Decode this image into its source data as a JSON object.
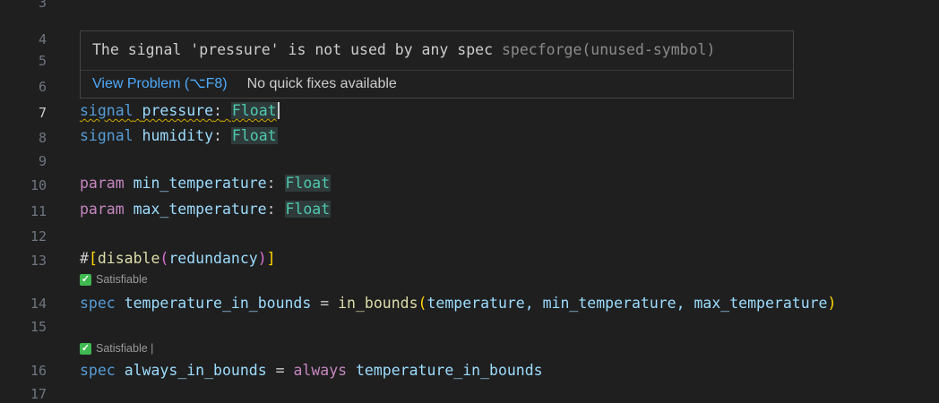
{
  "line_numbers": [
    "3",
    "4",
    "5",
    "6",
    "7",
    "8",
    "9",
    "10",
    "11",
    "12",
    "13",
    "14",
    "15",
    "16",
    "17"
  ],
  "code": {
    "l7": {
      "kw": "signal",
      "name": "pressure",
      "colon": ":",
      "type": "Float"
    },
    "l8": {
      "kw": "signal",
      "name": "humidity",
      "colon": ":",
      "type": "Float"
    },
    "l10": {
      "kw": "param",
      "name": "min_temperature",
      "colon": ":",
      "type": "Float"
    },
    "l11": {
      "kw": "param",
      "name": "max_temperature",
      "colon": ":",
      "type": "Float"
    },
    "l13": {
      "hash": "#",
      "open": "[",
      "fn": "disable",
      "popen": "(",
      "arg": "redundancy",
      "pclose": ")",
      "close": "]"
    },
    "l14": {
      "kw": "spec",
      "name": "temperature_in_bounds",
      "eq": " = ",
      "fn": "in_bounds",
      "open": "(",
      "args": "temperature, min_temperature, max_temperature",
      "close": ")"
    },
    "l16": {
      "kw": "spec",
      "name": "always_in_bounds",
      "eq": " = ",
      "kw2": "always",
      "ref": "temperature_in_bounds"
    }
  },
  "codelens": {
    "c1": {
      "icon": "✓",
      "text": "Satisfiable"
    },
    "c2": {
      "icon": "✓",
      "text": "Satisfiable |"
    }
  },
  "hover": {
    "message": "The signal 'pressure' is not used by any spec",
    "source": "specforge(unused-symbol)",
    "view_problem": "View Problem (⌥F8)",
    "no_quick_fixes": "No quick fixes available"
  },
  "colors": {
    "background": "#1f1f1f",
    "link": "#4daafc",
    "type": "#4ec9b0",
    "keyword_blue": "#569cd6",
    "keyword_purple": "#c586c0",
    "warning_squiggle": "#cca700",
    "check_green": "#3fb950"
  }
}
